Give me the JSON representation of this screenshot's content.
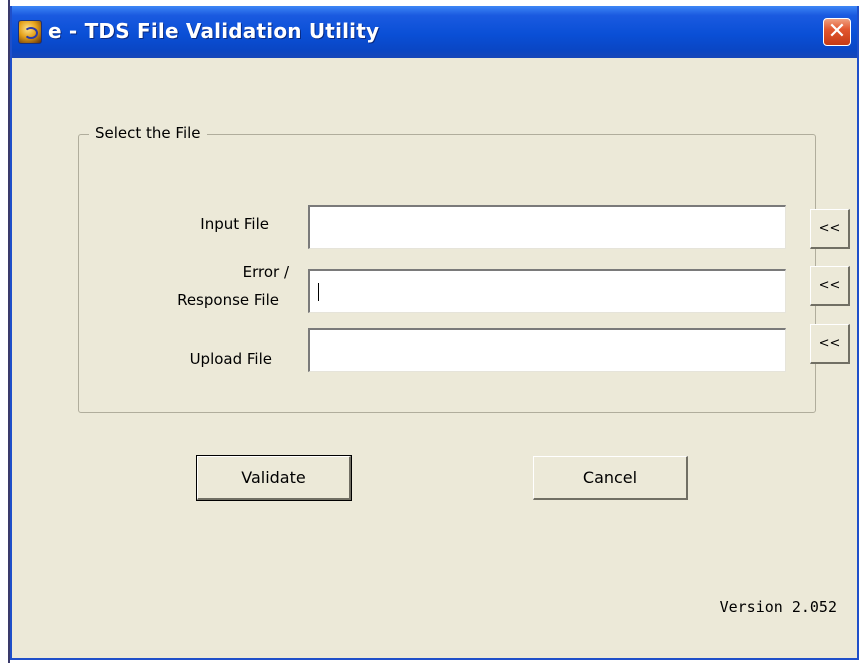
{
  "window": {
    "title": "e - TDS File  Validation Utility",
    "icon": "app-logo-icon",
    "close_icon": "close-icon"
  },
  "group": {
    "legend": "Select the File"
  },
  "fields": {
    "input_label": "Input File",
    "error_label_line1": "Error /",
    "error_label_line2": "Response File",
    "upload_label": "Upload File",
    "input_value": "",
    "error_value": "",
    "upload_value": ""
  },
  "browse": {
    "label": "<<"
  },
  "buttons": {
    "validate": "Validate",
    "cancel": "Cancel"
  },
  "footer": {
    "version": "Version  2.052"
  },
  "colors": {
    "titlebar": "#0a4fd6",
    "dialog_bg": "#ece9d8",
    "close": "#e2572f"
  }
}
